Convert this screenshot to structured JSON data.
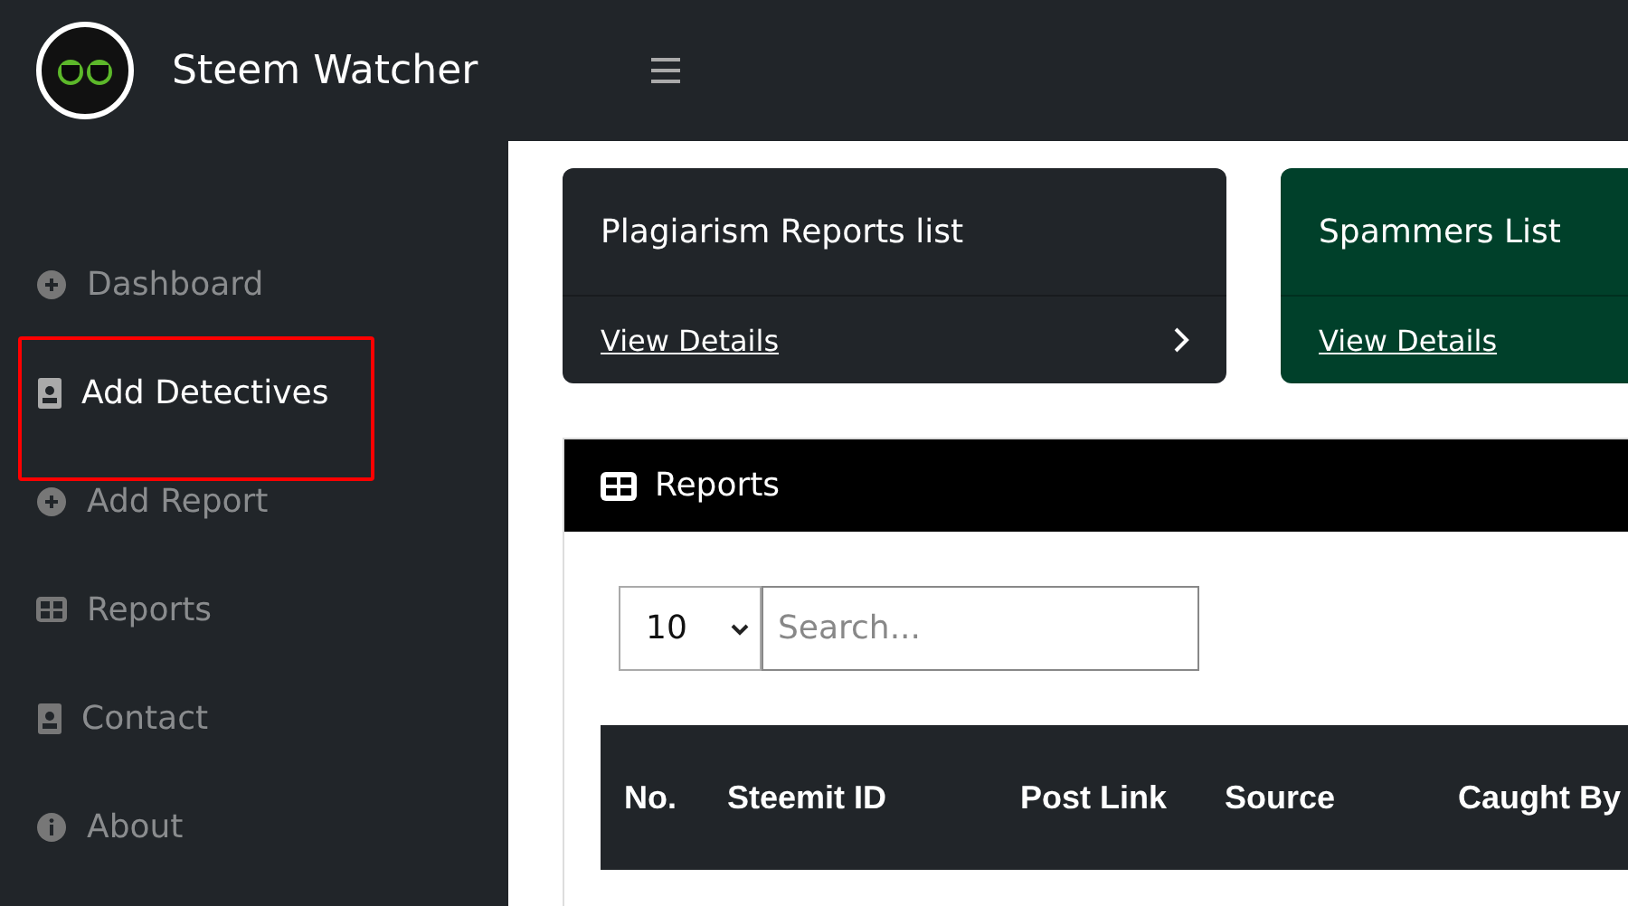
{
  "brand": {
    "title": "Steem Watcher"
  },
  "sidebar": {
    "items": [
      {
        "label": "Dashboard",
        "kind": "plus",
        "selected": false,
        "highlighted": false
      },
      {
        "label": "Add Detectives",
        "kind": "card",
        "selected": true,
        "highlighted": true
      },
      {
        "label": "Add Report",
        "kind": "plus",
        "selected": false,
        "highlighted": false
      },
      {
        "label": "Reports",
        "kind": "table",
        "selected": false,
        "highlighted": false
      },
      {
        "label": "Contact",
        "kind": "card",
        "selected": false,
        "highlighted": false
      },
      {
        "label": "About",
        "kind": "info",
        "selected": false,
        "highlighted": false
      }
    ]
  },
  "cards": [
    {
      "title": "Plagiarism Reports list",
      "link": "View Details",
      "color": "#212529"
    },
    {
      "title": "Spammers List",
      "link": "View Details",
      "color": "#00402a"
    }
  ],
  "reports": {
    "title": "Reports",
    "page_size": "10",
    "search": {
      "placeholder": "Search..."
    },
    "table": {
      "columns": [
        "No.",
        "Steemit ID",
        "Post Link",
        "Source",
        "Caught By"
      ]
    }
  }
}
